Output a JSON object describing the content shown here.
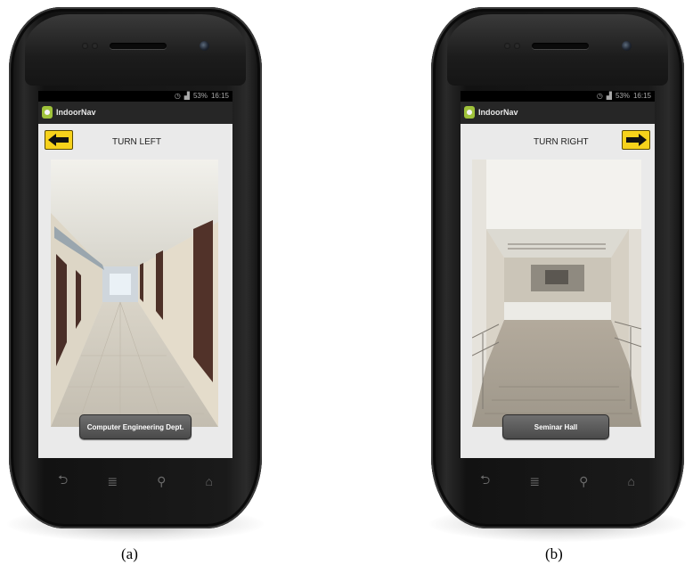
{
  "panels": [
    {
      "status": "16:15",
      "battery": "53%",
      "app_title": "IndoorNav",
      "direction": "TURN LEFT",
      "arrow": "left-arrow-icon",
      "destination": "Computer Engineering Dept.",
      "caption": "(a)"
    },
    {
      "status": "16:15",
      "battery": "53%",
      "app_title": "IndoorNav",
      "direction": "TURN RIGHT",
      "arrow": "right-arrow-icon",
      "destination": "Seminar Hall",
      "caption": "(b)"
    }
  ],
  "nav_buttons": [
    "back-icon",
    "menu-icon",
    "search-icon",
    "home-icon"
  ],
  "colors": {
    "arrow_bg": "#f7d21b",
    "screen_bg": "#eaeaea",
    "phone_body": "#151515"
  }
}
